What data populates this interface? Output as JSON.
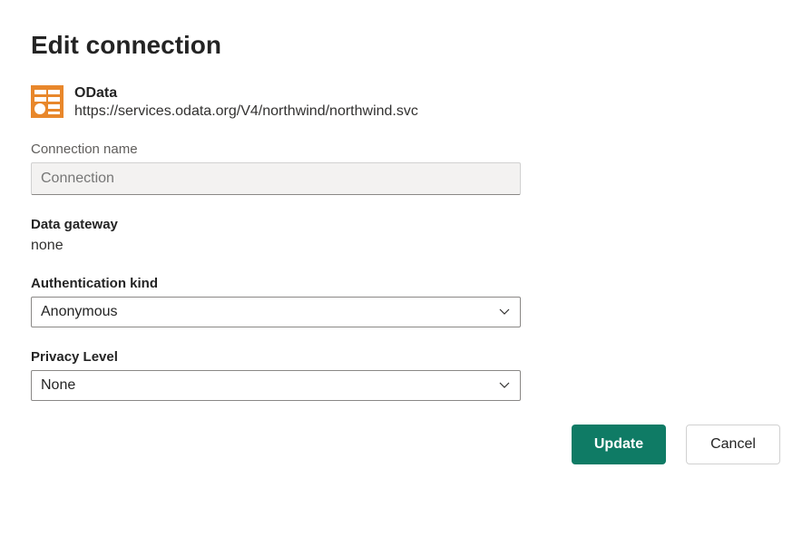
{
  "page": {
    "title": "Edit connection"
  },
  "connector": {
    "name": "OData",
    "url": "https://services.odata.org/V4/northwind/northwind.svc"
  },
  "connection_name": {
    "label": "Connection name",
    "placeholder": "Connection",
    "value": ""
  },
  "data_gateway": {
    "label": "Data gateway",
    "value": "none"
  },
  "auth_kind": {
    "label": "Authentication kind",
    "selected": "Anonymous"
  },
  "privacy_level": {
    "label": "Privacy Level",
    "selected": "None"
  },
  "buttons": {
    "update": "Update",
    "cancel": "Cancel"
  },
  "colors": {
    "primary": "#0f7b65",
    "icon_orange": "#e8872b"
  }
}
